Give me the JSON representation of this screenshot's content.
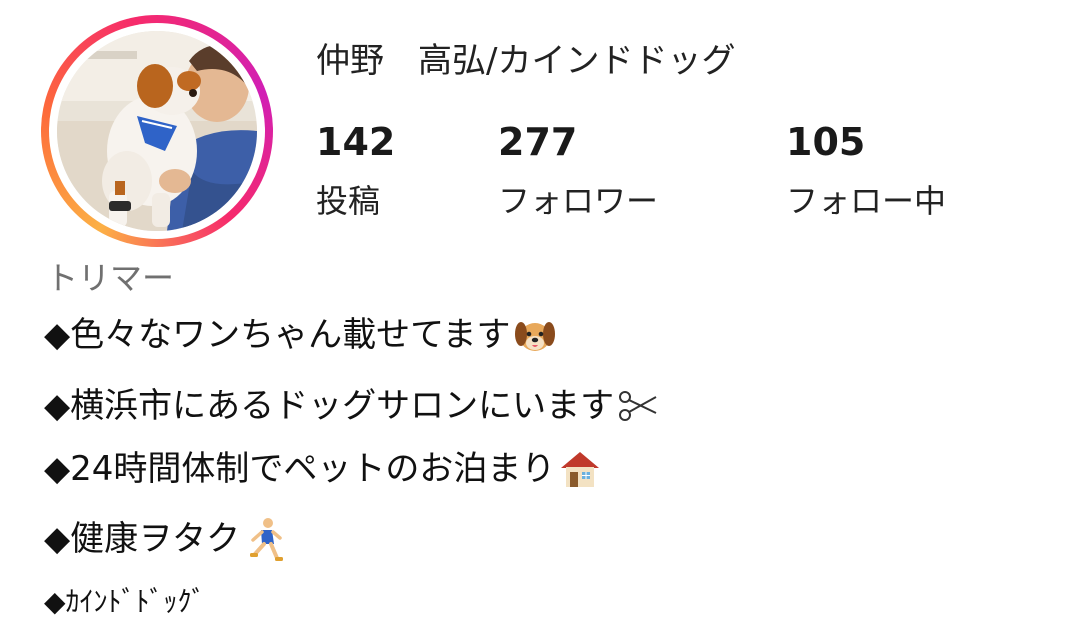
{
  "profile": {
    "name": "仲野　高弘/カインドドッグ",
    "avatar": "profile-photo-dog-and-man",
    "ring_colors": [
      "#fcb045",
      "#fd6a3a",
      "#f62a6c",
      "#d11fb5"
    ]
  },
  "stats": [
    {
      "count": "142",
      "label": "投稿"
    },
    {
      "count": "277",
      "label": "フォロワー"
    },
    {
      "count": "105",
      "label": "フォロー中"
    }
  ],
  "bio": {
    "category": "トリマー",
    "lines": [
      {
        "text": "◆色々なワンちゃん載せてます",
        "icon": "dog-face-emoji"
      },
      {
        "text": "◆横浜市にあるドッグサロンにいます",
        "icon": "scissors-emoji"
      },
      {
        "text": "◆24時間体制でペットのお泊まり",
        "icon": "house-emoji"
      },
      {
        "text": "◆健康ヲタク",
        "icon": "runner-emoji"
      },
      {
        "text": "◆ｶｲﾝﾄﾞﾄﾞｯｸﾞ",
        "icon": ""
      }
    ]
  }
}
